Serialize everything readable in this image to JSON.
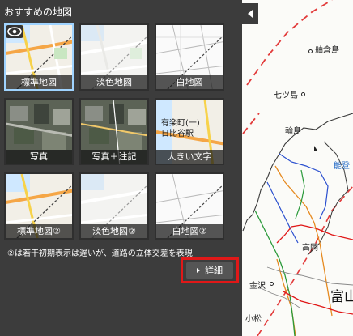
{
  "panel": {
    "title": "おすすめの地図",
    "tiles": [
      {
        "label": "標準地図",
        "style": "standard"
      },
      {
        "label": "淡色地図",
        "style": "pale"
      },
      {
        "label": "白地図",
        "style": "white"
      },
      {
        "label": "写真",
        "style": "photo"
      },
      {
        "label": "写真＋注記",
        "style": "photo"
      },
      {
        "label": "大きい文字",
        "style": "large"
      },
      {
        "label": "標準地図②",
        "style": "standard"
      },
      {
        "label": "淡色地図②",
        "style": "pale"
      },
      {
        "label": "白地図②",
        "style": "white"
      }
    ],
    "large_text_sample": {
      "line1": "有楽町(一)",
      "line2": "日比谷駅"
    },
    "note": "②は若干初期表示は遅いが、道路の立体交差を表現",
    "detail_label": "詳細",
    "eye_icon": "eye-icon"
  },
  "map": {
    "places": [
      {
        "name": "舳倉島",
        "kind": "normal"
      },
      {
        "name": "七ツ島",
        "kind": "normal"
      },
      {
        "name": "輪島",
        "kind": "normal"
      },
      {
        "name": "能登",
        "kind": "blue"
      },
      {
        "name": "高岡",
        "kind": "normal"
      },
      {
        "name": "金沢",
        "kind": "normal"
      },
      {
        "name": "小松",
        "kind": "normal"
      },
      {
        "name": "富山",
        "kind": "big"
      }
    ]
  },
  "colors": {
    "panel_bg": "#3c3c3c",
    "highlight_red": "#e01818",
    "selected_border": "#9fd3ff"
  }
}
